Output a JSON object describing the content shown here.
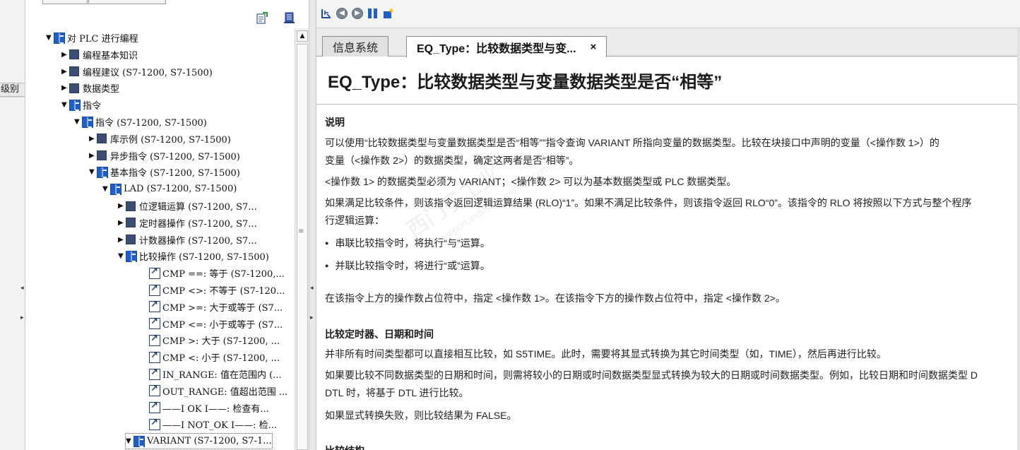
{
  "left_strip": {
    "label": "级别"
  },
  "tree": {
    "rows": [
      {
        "label": "对 PLC 进行编程"
      },
      {
        "label": "编程基本知识"
      },
      {
        "label": "编程建议 (S7-1200, S7-1500)"
      },
      {
        "label": "数据类型"
      },
      {
        "label": "指令"
      },
      {
        "label": "指令 (S7-1200, S7-1500)"
      },
      {
        "label": "库示例 (S7-1200, S7-1500)"
      },
      {
        "label": "异步指令 (S7-1200, S7-1500)"
      },
      {
        "label": "基本指令 (S7-1200, S7-1500)"
      },
      {
        "label": "LAD (S7-1200, S7-1500)"
      },
      {
        "label": "位逻辑运算 (S7-1200, S7..."
      },
      {
        "label": "定时器操作 (S7-1200, S7..."
      },
      {
        "label": "计数器操作 (S7-1200, S7..."
      },
      {
        "label": "比较操作 (S7-1200, S7-1500)"
      },
      {
        "label": "CMP ==: 等于 (S7-1200,..."
      },
      {
        "label": "CMP <>: 不等于 (S7-120..."
      },
      {
        "label": "CMP >=: 大于或等于 (S7..."
      },
      {
        "label": "CMP <=: 小于或等于 (S7..."
      },
      {
        "label": "CMP >: 大于 (S7-1200, ..."
      },
      {
        "label": "CMP <: 小于 (S7-1200, ..."
      },
      {
        "label": "IN_RANGE: 值在范围内 (..."
      },
      {
        "label": "OUT_RANGE: 值超出范围 ..."
      },
      {
        "label": "——I OK I——: 检查有..."
      },
      {
        "label": "——I NOT_OK I——: 检..."
      },
      {
        "label": "VARIANT (S7-1200, S7-1..."
      }
    ]
  },
  "doc_tabs": {
    "inactive_label": "信息系统",
    "active_label": "EQ_Type：比较数据类型与变...",
    "close_glyph": "×"
  },
  "doc": {
    "title": "EQ_Type：比较数据类型与变量数据类型是否“相等”",
    "h_desc": "说明",
    "p1a": "可以使用“比较数据类型与变量数据类型是否“相等””指令查询 VARIANT 所指向变量的数据类型。比较在块接口中声明的变量（<操作数 1>）的",
    "p1b": "变量（<操作数 2>）的数据类型，确定这两者是否“相等”。",
    "p2": "<操作数 1> 的数据类型必须为 VARIANT；<操作数 2> 可以为基本数据类型或 PLC 数据类型。",
    "p3a": "如果满足比较条件，则该指令返回逻辑运算结果 (RLO)“1”。如果不满足比较条件，则该指令返回 RLO“0”。该指令的 RLO 将按照以下方式与整个程序",
    "p3b": "行逻辑运算：",
    "b1": "串联比较指令时，将执行“与”运算。",
    "b2": "并联比较指令时，将进行“或”运算。",
    "p4": "在该指令上方的操作数占位符中，指定 <操作数 1>。在该指令下方的操作数占位符中，指定 <操作数 2>。",
    "h_time": "比较定时器、日期和时间",
    "p5": "并非所有时间类型都可以直接相互比较，如 S5TIME。此时，需要将其显式转换为其它时间类型（如，TIME），然后再进行比较。",
    "p6a": "如果要比较不同数据类型的日期和时间，则需将较小的日期或时间数据类型显式转换为较大的日期或时间数据类型。例如，比较日期和时间数据类型 D",
    "p6b": "DTL 时，将基于 DTL 进行比较。",
    "p7": "如果显式转换失败，则比较结果为 FALSE。",
    "h_struct": "比较结构"
  },
  "watermark": {
    "line1": "西门子工业",
    "line2": "support.industry.siemens.com"
  },
  "colors": {
    "book_blue": "#1f5fc8",
    "square_navy": "#3a4f73",
    "tab_border": "#8a8a8a"
  }
}
